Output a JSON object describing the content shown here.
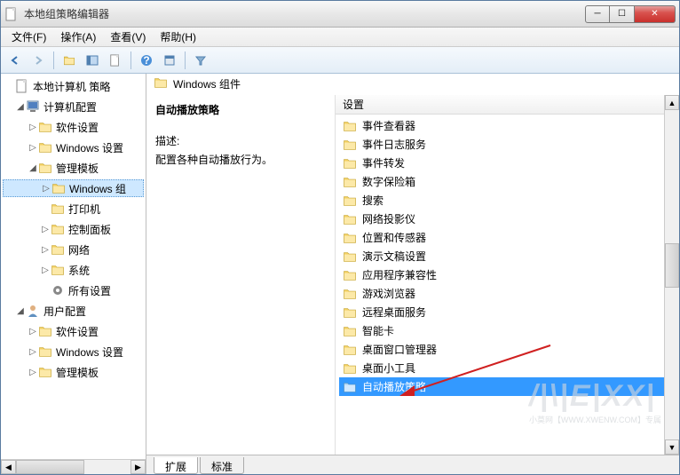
{
  "window": {
    "title": "本地组策略编辑器"
  },
  "menu": {
    "file": "文件(F)",
    "action": "操作(A)",
    "view": "查看(V)",
    "help": "帮助(H)"
  },
  "tree": {
    "root": "本地计算机 策略",
    "computer_config": "计算机配置",
    "software_settings": "软件设置",
    "windows_settings": "Windows 设置",
    "admin_templates": "管理模板",
    "windows_components": "Windows 组",
    "printers": "打印机",
    "control_panel": "控制面板",
    "network": "网络",
    "system": "系统",
    "all_settings": "所有设置",
    "user_config": "用户配置",
    "u_software": "软件设置",
    "u_windows": "Windows 设置",
    "u_admin": "管理模板"
  },
  "path": {
    "label": "Windows 组件"
  },
  "desc": {
    "heading": "自动播放策略",
    "label": "描述:",
    "text": "配置各种自动播放行为。"
  },
  "list": {
    "header": "设置",
    "items": [
      "事件查看器",
      "事件日志服务",
      "事件转发",
      "数字保险箱",
      "搜索",
      "网络投影仪",
      "位置和传感器",
      "演示文稿设置",
      "应用程序兼容性",
      "游戏浏览器",
      "远程桌面服务",
      "智能卡",
      "桌面窗口管理器",
      "桌面小工具",
      "自动播放策略"
    ]
  },
  "tabs": {
    "extended": "扩展",
    "standard": "标准"
  },
  "watermark": {
    "main": "/|\\|E|XX|",
    "sub": "小莫网【WWW.XWENW.COM】专属"
  }
}
